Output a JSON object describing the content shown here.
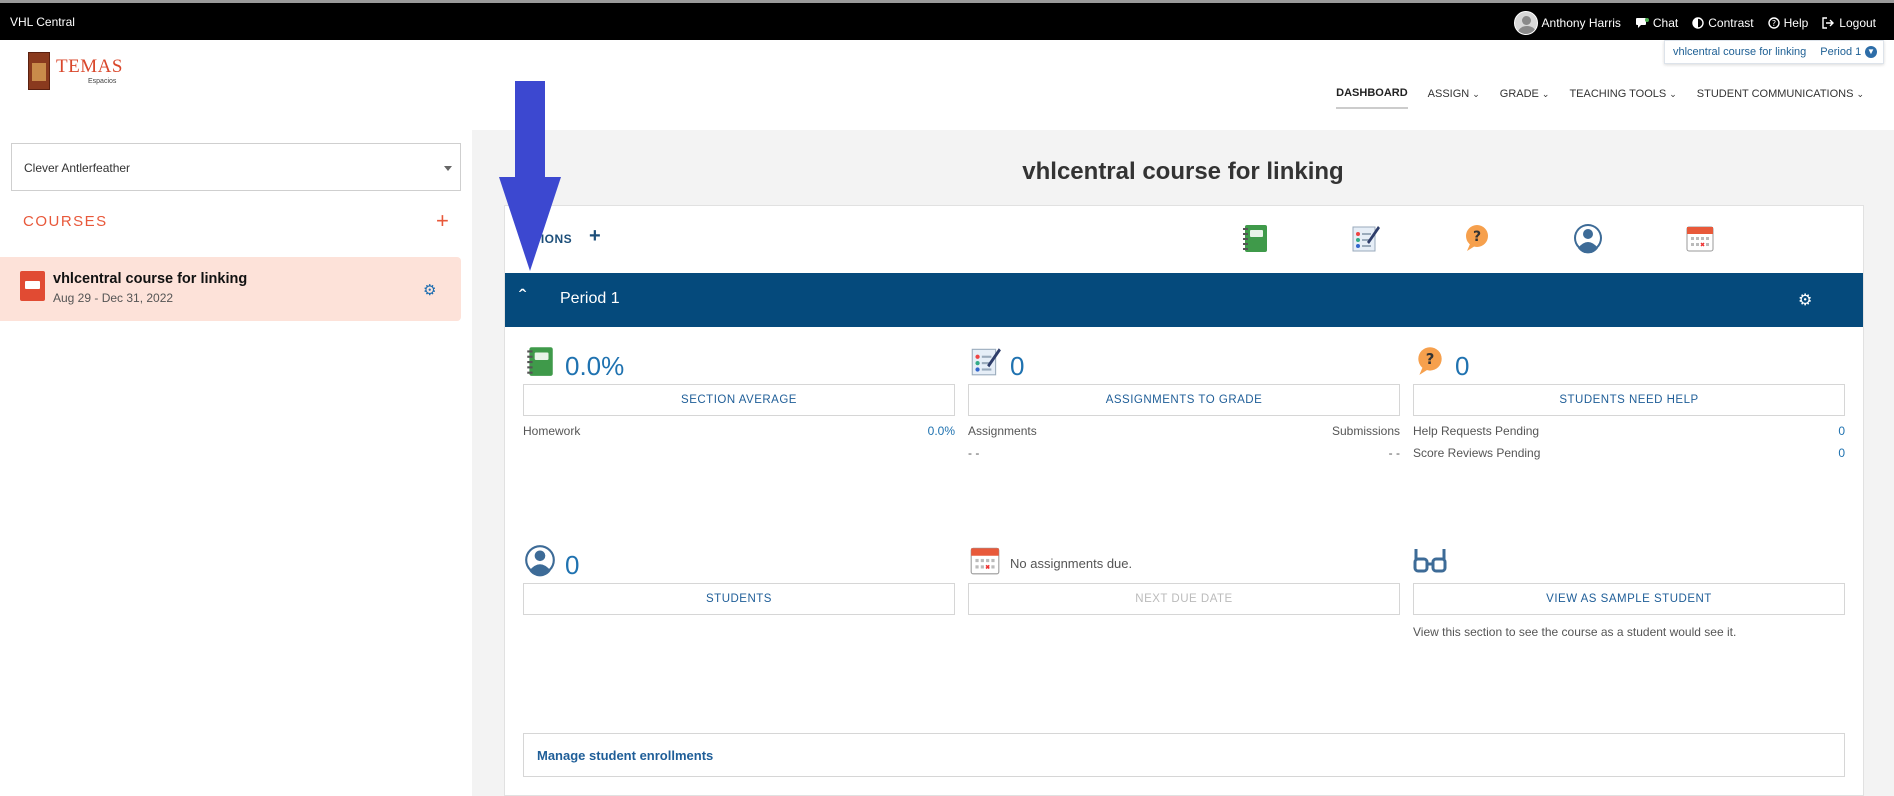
{
  "topbar": {
    "brand": "VHL Central",
    "user": "Anthony Harris",
    "chat": "Chat",
    "contrast": "Contrast",
    "help": "Help",
    "logout": "Logout"
  },
  "course_switch": {
    "course": "vhlcentral course for linking",
    "period": "Period 1"
  },
  "logo": {
    "title": "TEMAS",
    "subtitle": "Espacios"
  },
  "nav": {
    "dashboard": "DASHBOARD",
    "assign": "ASSIGN",
    "grade": "GRADE",
    "teaching_tools": "TEACHING TOOLS",
    "student_communications": "STUDENT COMMUNICATIONS"
  },
  "sidebar": {
    "selected_user": "Clever Antlerfeather",
    "courses_heading": "COURSES",
    "course": {
      "name": "vhlcentral course for linking",
      "dates": "Aug 29 - Dec 31, 2022"
    }
  },
  "main": {
    "title": "vhlcentral course for linking",
    "actions_label": "TIONS",
    "period": "Period 1",
    "tiles": {
      "average": {
        "value": "0.0%",
        "button": "SECTION AVERAGE",
        "row1_label": "Homework",
        "row1_value": "0.0%"
      },
      "grade": {
        "value": "0",
        "button": "ASSIGNMENTS TO GRADE",
        "row1_label": "Assignments",
        "row1_value": "Submissions",
        "row2_label": "- -",
        "row2_value": "- -"
      },
      "help": {
        "value": "0",
        "button": "STUDENTS NEED HELP",
        "row1_label": "Help Requests Pending",
        "row1_value": "0",
        "row2_label": "Score Reviews Pending",
        "row2_value": "0"
      },
      "students": {
        "value": "0",
        "button": "STUDENTS"
      },
      "due": {
        "value": "No assignments due.",
        "button": "NEXT DUE DATE"
      },
      "sample": {
        "button": "VIEW AS SAMPLE STUDENT",
        "note": "View this section to see the course as a student would see it."
      }
    },
    "manage_link": "Manage student enrollments"
  },
  "colors": {
    "accent": "#e8583a",
    "period_bar": "#054a7c",
    "link": "#1f5e98",
    "annotation_arrow": "#3c48d0"
  }
}
